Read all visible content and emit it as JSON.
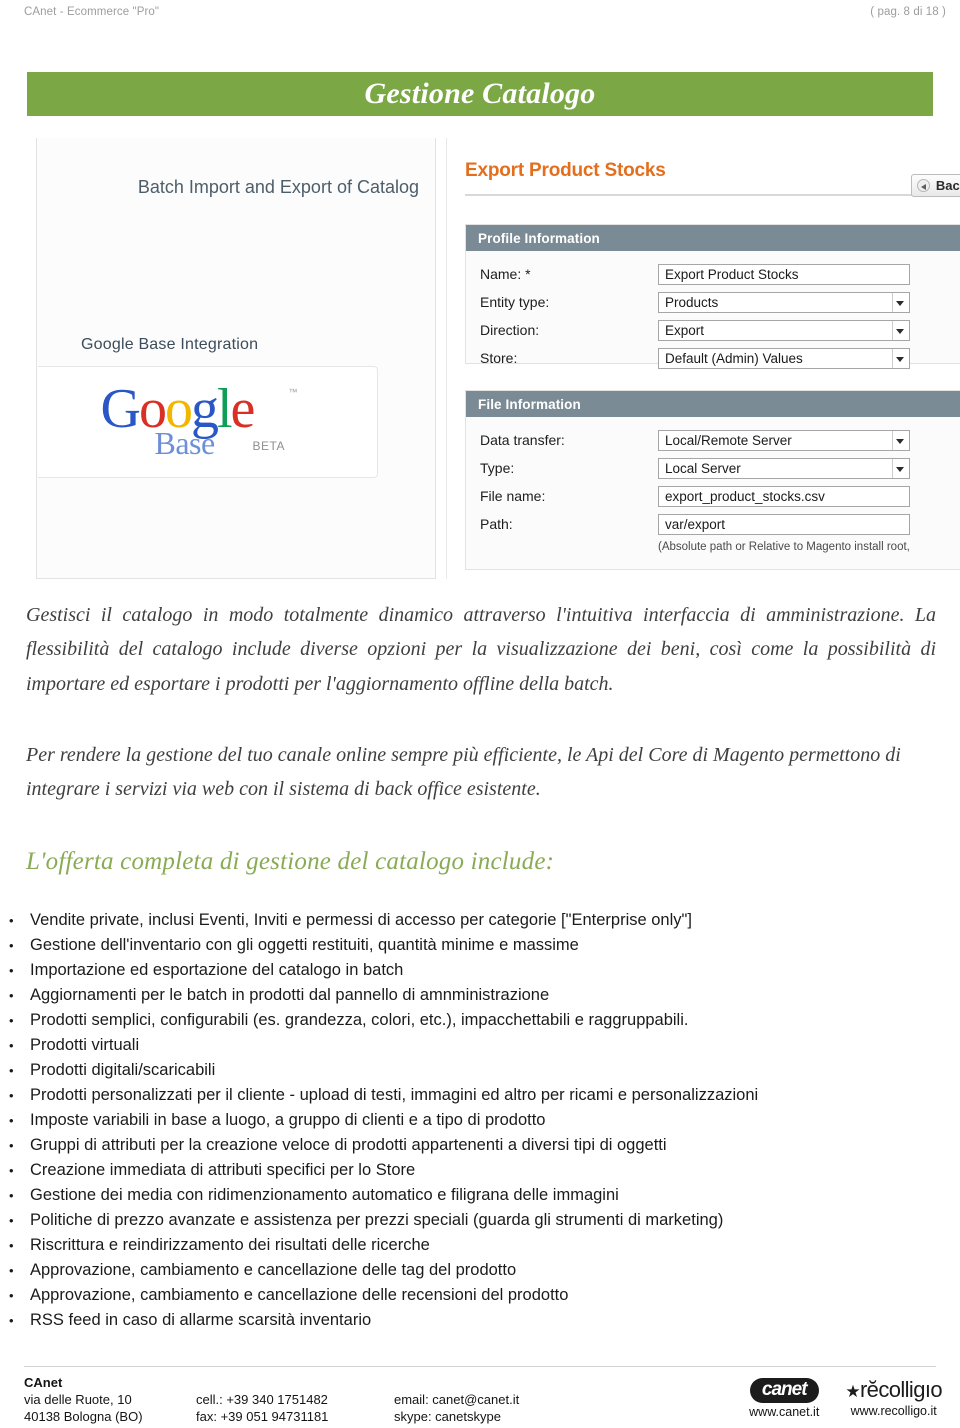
{
  "page_header": {
    "left": "CAnet - Ecommerce \"Pro\"",
    "right": "( pag. 8 di 18 )"
  },
  "banner": {
    "title": "Gestione Catalogo",
    "bg_color": "#7ba845"
  },
  "screenshot": {
    "left_panel": {
      "caption_batch": "Batch Import and Export of Catalog",
      "caption_google": "Google Base Integration",
      "google_logo": {
        "letters": [
          "G",
          "o",
          "o",
          "g",
          "l",
          "e"
        ],
        "base_word": "Base",
        "beta_word": "BETA",
        "tm": "™"
      }
    },
    "right_panel": {
      "title": "Export Product Stocks",
      "back_button": "Back",
      "profile_panel": {
        "heading": "Profile Information",
        "fields": [
          {
            "label": "Name: *",
            "value": "Export Product Stocks",
            "control": "text"
          },
          {
            "label": "Entity type:",
            "value": "Products",
            "control": "select"
          },
          {
            "label": "Direction:",
            "value": "Export",
            "control": "select"
          },
          {
            "label": "Store:",
            "value": "Default (Admin) Values",
            "control": "select"
          }
        ]
      },
      "file_panel": {
        "heading": "File Information",
        "fields": [
          {
            "label": "Data transfer:",
            "value": "Local/Remote Server",
            "control": "select"
          },
          {
            "label": "Type:",
            "value": "Local Server",
            "control": "select"
          },
          {
            "label": "File name:",
            "value": "export_product_stocks.csv",
            "control": "text"
          },
          {
            "label": "Path:",
            "value": "var/export",
            "control": "text"
          }
        ],
        "hint": "(Absolute path or Relative to Magento install root, "
      }
    }
  },
  "body": {
    "paragraph_1": "Gestisci il catalogo in modo totalmente dinamico attraverso l'intuitiva interfaccia di amministrazione. La flessibilità del catalogo include diverse opzioni per la visualizzazione dei beni, così come la possibilità di importare ed esportare i prodotti per l'aggiornamento offline della batch.",
    "paragraph_2": "Per rendere la gestione del tuo canale online sempre più efficiente, le Api del Core di Magento permettono di integrare i servizi via web con il sistema di back office esistente.",
    "green_heading": "L'offerta completa di gestione del catalogo include:",
    "green_heading_color": "#8aab55",
    "bullets": [
      "Vendite private, inclusi Eventi, Inviti e permessi di accesso per categorie [\"Enterprise only\"]",
      "Gestione dell'inventario con gli oggetti restituiti, quantità minime e massime",
      "Importazione ed esportazione del catalogo in batch",
      "Aggiornamenti per le batch in prodotti dal pannello di amnministrazione",
      "Prodotti semplici, configurabili (es. grandezza, colori, etc.), impacchettabili e raggruppabili.",
      "Prodotti virtuali",
      "Prodotti digitali/scaricabili",
      "Prodotti personalizzati per il cliente - upload di testi, immagini ed altro per ricami e personalizzazioni",
      "Imposte variabili in base a luogo, a gruppo di clienti e a tipo di prodotto",
      "Gruppi di attributi per la creazione veloce di prodotti appartenenti a diversi tipi di oggetti",
      "Creazione immediata di attributi specifici per lo Store",
      "Gestione dei media con ridimenzionamento automatico e filigrana delle immagini",
      "Politiche di prezzo avanzate e assistenza per prezzi speciali (guarda gli strumenti di marketing)",
      "Riscrittura e reindirizzamento dei risultati delle ricerche",
      "Approvazione, cambiamento e cancellazione delle tag del prodotto",
      "Approvazione, cambiamento e cancellazione delle recensioni del prodotto",
      "RSS feed in caso di allarme scarsità inventario"
    ]
  },
  "footer": {
    "company": "CAnet",
    "address_line1": "via delle Ruote, 10",
    "address_line2": "40138 Bologna (BO)",
    "phone_cell": "cell.: +39 340 1751482",
    "phone_fax": "fax: +39 051 94731181",
    "email": "email: canet@canet.it",
    "skype": "skype: canetskype",
    "logo_canet_text": "canet",
    "logo_canet_url": "www.canet.it",
    "logo_recolligo_star": "★",
    "logo_recolligo_text": "rĕcolligıo",
    "logo_recolligo_url": "www.recolligo.it"
  }
}
